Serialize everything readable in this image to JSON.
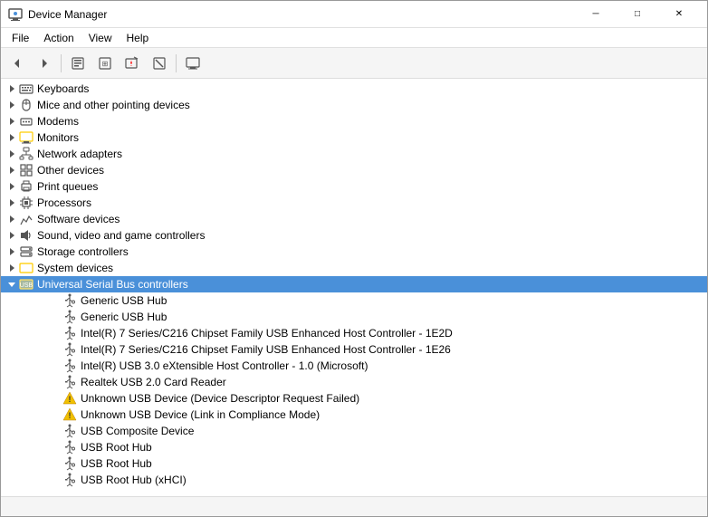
{
  "window": {
    "title": "Device Manager",
    "icon": "🖥"
  },
  "titlebar": {
    "minimize_label": "─",
    "maximize_label": "□",
    "close_label": "✕"
  },
  "menu": {
    "items": [
      "File",
      "Action",
      "View",
      "Help"
    ]
  },
  "toolbar": {
    "buttons": [
      "←",
      "→",
      "⊞",
      "□",
      "⚠",
      "⊠",
      "🖥"
    ]
  },
  "tree": {
    "items": [
      {
        "id": "keyboards",
        "label": "Keyboards",
        "level": 1,
        "expanded": false,
        "icon": "keyboard",
        "type": "category"
      },
      {
        "id": "mice",
        "label": "Mice and other pointing devices",
        "level": 1,
        "expanded": false,
        "icon": "mouse",
        "type": "category"
      },
      {
        "id": "modems",
        "label": "Modems",
        "level": 1,
        "expanded": false,
        "icon": "modem",
        "type": "category"
      },
      {
        "id": "monitors",
        "label": "Monitors",
        "level": 1,
        "expanded": false,
        "icon": "monitor",
        "type": "category"
      },
      {
        "id": "network",
        "label": "Network adapters",
        "level": 1,
        "expanded": false,
        "icon": "network",
        "type": "category"
      },
      {
        "id": "other",
        "label": "Other devices",
        "level": 1,
        "expanded": false,
        "icon": "other",
        "type": "category"
      },
      {
        "id": "print",
        "label": "Print queues",
        "level": 1,
        "expanded": false,
        "icon": "print",
        "type": "category"
      },
      {
        "id": "processors",
        "label": "Processors",
        "level": 1,
        "expanded": false,
        "icon": "processor",
        "type": "category"
      },
      {
        "id": "software",
        "label": "Software devices",
        "level": 1,
        "expanded": false,
        "icon": "software",
        "type": "category"
      },
      {
        "id": "sound",
        "label": "Sound, video and game controllers",
        "level": 1,
        "expanded": false,
        "icon": "sound",
        "type": "category"
      },
      {
        "id": "storage",
        "label": "Storage controllers",
        "level": 1,
        "expanded": false,
        "icon": "storage",
        "type": "category"
      },
      {
        "id": "system",
        "label": "System devices",
        "level": 1,
        "expanded": false,
        "icon": "system",
        "type": "category"
      },
      {
        "id": "usb",
        "label": "Universal Serial Bus controllers",
        "level": 1,
        "expanded": true,
        "icon": "usb_cat",
        "type": "category",
        "selected": true
      },
      {
        "id": "usb1",
        "label": "Generic USB Hub",
        "level": 2,
        "icon": "usb",
        "type": "device"
      },
      {
        "id": "usb2",
        "label": "Generic USB Hub",
        "level": 2,
        "icon": "usb",
        "type": "device"
      },
      {
        "id": "usb3",
        "label": "Intel(R) 7 Series/C216 Chipset Family USB Enhanced Host Controller - 1E2D",
        "level": 2,
        "icon": "usb",
        "type": "device"
      },
      {
        "id": "usb4",
        "label": "Intel(R) 7 Series/C216 Chipset Family USB Enhanced Host Controller - 1E26",
        "level": 2,
        "icon": "usb",
        "type": "device"
      },
      {
        "id": "usb5",
        "label": "Intel(R) USB 3.0 eXtensible Host Controller - 1.0 (Microsoft)",
        "level": 2,
        "icon": "usb",
        "type": "device"
      },
      {
        "id": "usb6",
        "label": "Realtek USB 2.0 Card Reader",
        "level": 2,
        "icon": "usb",
        "type": "device"
      },
      {
        "id": "usb7",
        "label": "Unknown USB Device (Device Descriptor Request Failed)",
        "level": 2,
        "icon": "warning",
        "type": "device"
      },
      {
        "id": "usb8",
        "label": "Unknown USB Device (Link in Compliance Mode)",
        "level": 2,
        "icon": "warning",
        "type": "device"
      },
      {
        "id": "usb9",
        "label": "USB Composite Device",
        "level": 2,
        "icon": "usb",
        "type": "device"
      },
      {
        "id": "usb10",
        "label": "USB Root Hub",
        "level": 2,
        "icon": "usb",
        "type": "device"
      },
      {
        "id": "usb11",
        "label": "USB Root Hub",
        "level": 2,
        "icon": "usb",
        "type": "device"
      },
      {
        "id": "usb12",
        "label": "USB Root Hub (xHCI)",
        "level": 2,
        "icon": "usb",
        "type": "device"
      }
    ]
  },
  "status": {
    "text": ""
  }
}
